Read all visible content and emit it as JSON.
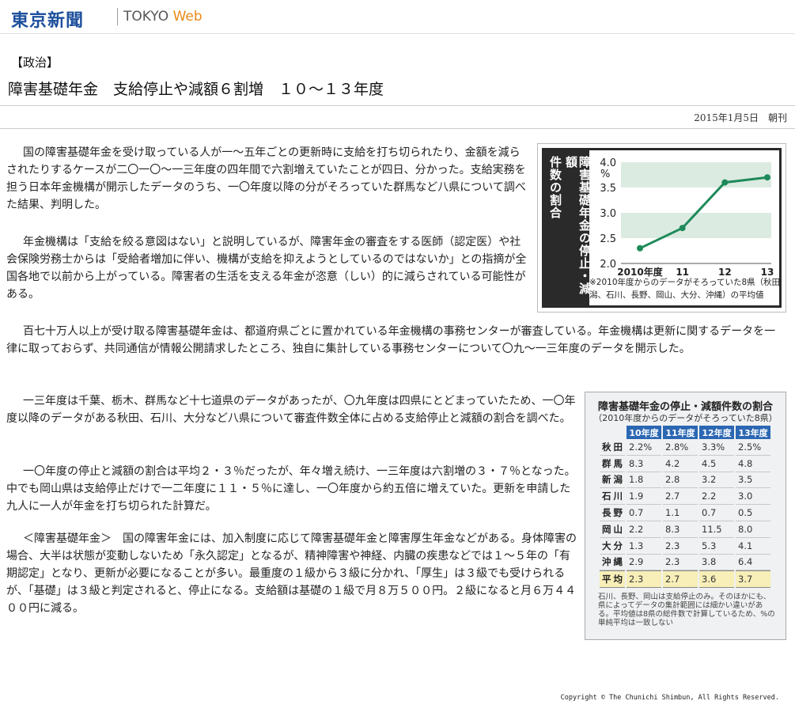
{
  "header": {
    "logo_ja": "東京新聞",
    "logo_en": "TOKYO",
    "logo_web": "Web"
  },
  "article": {
    "category": "【政治】",
    "headline": "障害基礎年金　支給停止や減額６割増　１０～１３年度",
    "date": "2015年1月5日　朝刊",
    "p1": "国の障害基礎年金を受け取っている人が一～五年ごとの更新時に支給を打ち切られたり、金額を減らされたりするケースが二〇一〇～一三年度の四年間で六割増えていたことが四日、分かった。支給実務を担う日本年金機構が開示したデータのうち、一〇年度以降の分がそろっていた群馬など八県について調べた結果、判明した。",
    "p2": "年金機構は「支給を絞る意図はない」と説明しているが、障害年金の審査をする医師（認定医）や社会保険労務士からは「受給者増加に伴い、機構が支給を抑えようとしているのではないか」との指摘が全国各地で以前から上がっている。障害者の生活を支える年金が恣意（しい）的に減らされている可能性がある。",
    "p3": "百七十万人以上が受け取る障害基礎年金は、都道府県ごとに置かれている年金機構の事務センターが審査している。年金機構は更新に関するデータを一律に取っておらず、共同通信が情報公開請求したところ、独自に集計している事務センターについて〇九～一三年度のデータを開示した。",
    "p4": "一三年度は千葉、栃木、群馬など十七道県のデータがあったが、〇九年度は四県にとどまっていたため、一〇年度以降のデータがある秋田、石川、大分など八県について審査件数全体に占める支給停止と減額の割合を調べた。",
    "p5": "一〇年度の停止と減額の割合は平均２・３％だったが、年々増え続け、一三年度は六割増の３・７％となった。中でも岡山県は支給停止だけで一二年度に１１・５％に達し、一〇年度から約五倍に増えていた。更新を申請した九人に一人が年金を打ち切られた計算だ。",
    "p6": "＜障害基礎年金＞　国の障害年金には、加入制度に応じて障害基礎年金と障害厚生年金などがある。身体障害の場合、大半は状態が変動しないため「永久認定」となるが、精神障害や神経、内臓の疾患などでは１～５年の「有期認定」となり、更新が必要になることが多い。最重度の１級から３級に分かれ、「厚生」は３級でも受けられるが、「基礎」は３級と判定されると、停止になる。支給額は基礎の１級で月８万５００円。２級になると月６万４４００円に減る。"
  },
  "chart_data": {
    "type": "line",
    "title": "障害基礎年金の停止・減額件数の割合",
    "unit": "%",
    "categories": [
      "2010年度",
      "11",
      "12",
      "13"
    ],
    "values": [
      2.3,
      2.7,
      3.6,
      3.7
    ],
    "ylim": [
      2.0,
      4.0
    ],
    "yticks": [
      "4.0",
      "3.5",
      "3.0",
      "2.5",
      "2.0"
    ],
    "note": "※2010年度からのデータがそろっていた8県（秋田、群馬、新潟、石川、長野、岡山、大分、沖縄）の平均値",
    "colors": {
      "line": "#1e8a5a",
      "band": "#dcebe1",
      "bg": "#2a2a2a"
    }
  },
  "table": {
    "title": "障害基礎年金の停止・減額件数の割合",
    "subtitle": "（2010年度からのデータがそろっていた8県）",
    "columns": [
      "10年度",
      "11年度",
      "12年度",
      "13年度"
    ],
    "rows": [
      {
        "pref": "秋田",
        "values": [
          "2.2%",
          "2.8%",
          "3.3%",
          "2.5%"
        ]
      },
      {
        "pref": "群馬",
        "values": [
          "8.3",
          "4.2",
          "4.5",
          "4.8"
        ]
      },
      {
        "pref": "新潟",
        "values": [
          "1.8",
          "2.8",
          "3.2",
          "3.5"
        ]
      },
      {
        "pref": "石川",
        "values": [
          "1.9",
          "2.7",
          "2.2",
          "3.0"
        ]
      },
      {
        "pref": "長野",
        "values": [
          "0.7",
          "1.1",
          "0.7",
          "0.5"
        ]
      },
      {
        "pref": "岡山",
        "values": [
          "2.2",
          "8.3",
          "11.5",
          "8.0"
        ]
      },
      {
        "pref": "大分",
        "values": [
          "1.3",
          "2.3",
          "5.3",
          "4.1"
        ]
      },
      {
        "pref": "沖縄",
        "values": [
          "2.9",
          "2.3",
          "3.8",
          "6.4"
        ]
      }
    ],
    "average": {
      "pref": "平均",
      "values": [
        "2.3",
        "2.7",
        "3.6",
        "3.7"
      ]
    },
    "note": "石川、長野、岡山は支給停止のみ。そのほかにも、県によってデータの集計範囲には細かい違いがある。平均値は8県の総件数で計算しているため、%の単純平均は一致しない"
  },
  "footer": {
    "copyright": "Copyright © The Chunichi Shimbun, All Rights Reserved."
  }
}
